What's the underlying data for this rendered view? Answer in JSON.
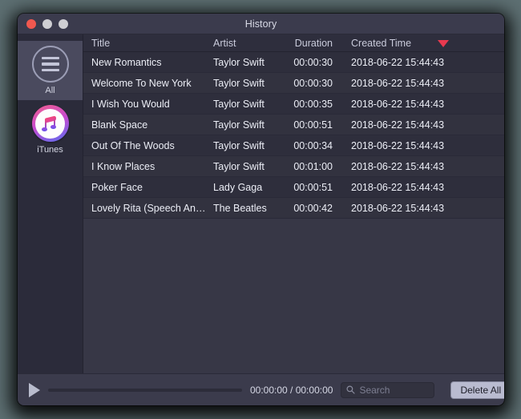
{
  "window": {
    "title": "History",
    "traffic_lights": [
      "close-button",
      "minimize-button",
      "maximize-button"
    ]
  },
  "sidebar": {
    "items": [
      {
        "label": "All",
        "icon": "hamburger-circle-icon",
        "selected": true
      },
      {
        "label": "iTunes",
        "icon": "itunes-icon",
        "selected": false
      }
    ]
  },
  "table": {
    "columns": [
      "Title",
      "Artist",
      "Duration",
      "Created Time"
    ],
    "sort": {
      "column": "Created Time",
      "direction": "descending",
      "indicator": "sort-descending-triangle",
      "color": "#e8394f"
    },
    "rows": [
      {
        "title": "New Romantics",
        "artist": "Taylor Swift",
        "duration": "00:00:30",
        "created": "2018-06-22 15:44:43"
      },
      {
        "title": "Welcome To New York",
        "artist": "Taylor Swift",
        "duration": "00:00:30",
        "created": "2018-06-22 15:44:43"
      },
      {
        "title": "I Wish You Would",
        "artist": "Taylor Swift",
        "duration": "00:00:35",
        "created": "2018-06-22 15:44:43"
      },
      {
        "title": "Blank Space",
        "artist": "Taylor Swift",
        "duration": "00:00:51",
        "created": "2018-06-22 15:44:43"
      },
      {
        "title": "Out Of The Woods",
        "artist": "Taylor Swift",
        "duration": "00:00:34",
        "created": "2018-06-22 15:44:43"
      },
      {
        "title": "I Know Places",
        "artist": "Taylor Swift",
        "duration": "00:01:00",
        "created": "2018-06-22 15:44:43"
      },
      {
        "title": "Poker Face",
        "artist": "Lady Gaga",
        "duration": "00:00:51",
        "created": "2018-06-22 15:44:43"
      },
      {
        "title": "Lovely Rita (Speech And …",
        "artist": "The Beatles",
        "duration": "00:00:42",
        "created": "2018-06-22 15:44:43"
      }
    ]
  },
  "player": {
    "play_icon": "play-icon",
    "progress_percent": 0,
    "time": "00:00:00 / 00:00:00"
  },
  "search": {
    "icon": "search-icon",
    "placeholder": "Search",
    "value": ""
  },
  "actions": {
    "delete_all_label": "Delete All"
  },
  "colors": {
    "window_bg": "#373746",
    "sidebar_bg": "#2b2b3a",
    "titlebar_bg": "#3b3b4d",
    "row_bg": "#2e2e3c",
    "row_alt_bg": "#32323f",
    "accent_sort": "#e8394f",
    "close_light": "#f1584f",
    "button_bg": "#b9bbd0"
  }
}
